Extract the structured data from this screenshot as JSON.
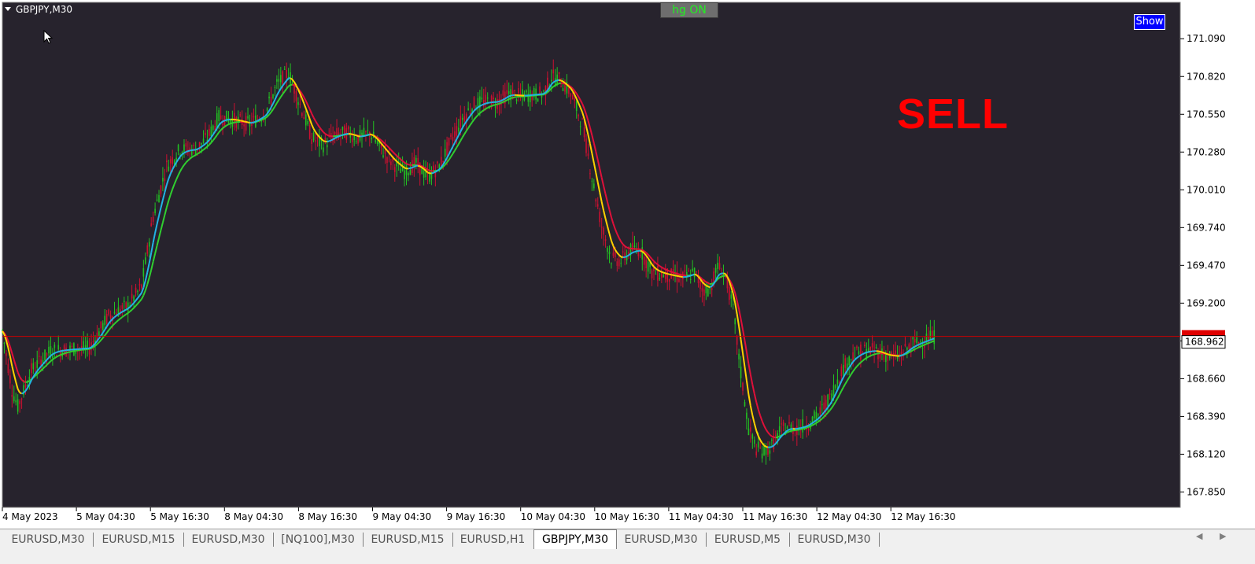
{
  "window": {
    "symbol_label": "GBPJPY,M30"
  },
  "toolbar": {
    "hg_label": "hg ON",
    "show_label": "Show"
  },
  "signal": {
    "text": "SELL",
    "color": "#ff0000"
  },
  "colors": {
    "background": "#27232d",
    "bull_candle": "#22c022",
    "bear_candle": "#cc1030",
    "fast_up": "#22b4e6",
    "fast_down": "#ffd200",
    "slow_up": "#30d030",
    "slow_down": "#e0103a",
    "price_line": "#cc0000",
    "axis_text": "#ffffff"
  },
  "chart_data": {
    "type": "line",
    "symbol": "GBPJPY",
    "timeframe": "M30",
    "ylim": [
      167.74,
      171.35
    ],
    "y_ticks": [
      "171.090",
      "170.820",
      "170.550",
      "170.280",
      "170.010",
      "169.740",
      "169.470",
      "169.200",
      "168.930",
      "168.660",
      "168.390",
      "168.120",
      "167.850"
    ],
    "x_ticks": [
      "4 May 2023",
      "5 May 04:30",
      "5 May 16:30",
      "8 May 04:30",
      "8 May 16:30",
      "9 May 04:30",
      "9 May 16:30",
      "10 May 04:30",
      "10 May 16:30",
      "11 May 04:30",
      "11 May 16:30",
      "12 May 04:30",
      "12 May 16:30"
    ],
    "current_price": 168.962,
    "current_price_label": "168.962",
    "grid": false,
    "price_path": [
      {
        "bar": 0,
        "price": 169.0
      },
      {
        "bar": 5,
        "price": 168.58
      },
      {
        "bar": 8,
        "price": 168.46
      },
      {
        "bar": 15,
        "price": 168.72
      },
      {
        "bar": 25,
        "price": 168.86
      },
      {
        "bar": 35,
        "price": 168.87
      },
      {
        "bar": 45,
        "price": 168.88
      },
      {
        "bar": 55,
        "price": 169.11
      },
      {
        "bar": 65,
        "price": 169.18
      },
      {
        "bar": 72,
        "price": 169.32
      },
      {
        "bar": 78,
        "price": 169.82
      },
      {
        "bar": 85,
        "price": 170.18
      },
      {
        "bar": 92,
        "price": 170.3
      },
      {
        "bar": 100,
        "price": 170.3
      },
      {
        "bar": 106,
        "price": 170.38
      },
      {
        "bar": 112,
        "price": 170.53
      },
      {
        "bar": 120,
        "price": 170.51
      },
      {
        "bar": 128,
        "price": 170.48
      },
      {
        "bar": 136,
        "price": 170.56
      },
      {
        "bar": 142,
        "price": 170.76
      },
      {
        "bar": 148,
        "price": 170.85
      },
      {
        "bar": 154,
        "price": 170.62
      },
      {
        "bar": 160,
        "price": 170.38
      },
      {
        "bar": 166,
        "price": 170.33
      },
      {
        "bar": 172,
        "price": 170.4
      },
      {
        "bar": 178,
        "price": 170.42
      },
      {
        "bar": 184,
        "price": 170.38
      },
      {
        "bar": 190,
        "price": 170.42
      },
      {
        "bar": 196,
        "price": 170.3
      },
      {
        "bar": 202,
        "price": 170.2
      },
      {
        "bar": 208,
        "price": 170.14
      },
      {
        "bar": 214,
        "price": 170.2
      },
      {
        "bar": 220,
        "price": 170.1
      },
      {
        "bar": 226,
        "price": 170.18
      },
      {
        "bar": 232,
        "price": 170.36
      },
      {
        "bar": 238,
        "price": 170.52
      },
      {
        "bar": 244,
        "price": 170.62
      },
      {
        "bar": 250,
        "price": 170.64
      },
      {
        "bar": 256,
        "price": 170.64
      },
      {
        "bar": 262,
        "price": 170.7
      },
      {
        "bar": 268,
        "price": 170.68
      },
      {
        "bar": 274,
        "price": 170.69
      },
      {
        "bar": 280,
        "price": 170.7
      },
      {
        "bar": 284,
        "price": 170.82
      },
      {
        "bar": 288,
        "price": 170.8
      },
      {
        "bar": 294,
        "price": 170.7
      },
      {
        "bar": 300,
        "price": 170.48
      },
      {
        "bar": 305,
        "price": 170.1
      },
      {
        "bar": 310,
        "price": 169.75
      },
      {
        "bar": 315,
        "price": 169.52
      },
      {
        "bar": 320,
        "price": 169.5
      },
      {
        "bar": 325,
        "price": 169.58
      },
      {
        "bar": 330,
        "price": 169.58
      },
      {
        "bar": 336,
        "price": 169.42
      },
      {
        "bar": 344,
        "price": 169.4
      },
      {
        "bar": 352,
        "price": 169.38
      },
      {
        "bar": 358,
        "price": 169.42
      },
      {
        "bar": 362,
        "price": 169.3
      },
      {
        "bar": 366,
        "price": 169.3
      },
      {
        "bar": 370,
        "price": 169.46
      },
      {
        "bar": 374,
        "price": 169.4
      },
      {
        "bar": 378,
        "price": 169.15
      },
      {
        "bar": 382,
        "price": 168.7
      },
      {
        "bar": 386,
        "price": 168.3
      },
      {
        "bar": 390,
        "price": 168.16
      },
      {
        "bar": 394,
        "price": 168.14
      },
      {
        "bar": 398,
        "price": 168.18
      },
      {
        "bar": 402,
        "price": 168.28
      },
      {
        "bar": 406,
        "price": 168.32
      },
      {
        "bar": 410,
        "price": 168.3
      },
      {
        "bar": 416,
        "price": 168.33
      },
      {
        "bar": 422,
        "price": 168.4
      },
      {
        "bar": 428,
        "price": 168.52
      },
      {
        "bar": 434,
        "price": 168.72
      },
      {
        "bar": 440,
        "price": 168.83
      },
      {
        "bar": 446,
        "price": 168.86
      },
      {
        "bar": 452,
        "price": 168.86
      },
      {
        "bar": 458,
        "price": 168.82
      },
      {
        "bar": 464,
        "price": 168.82
      },
      {
        "bar": 470,
        "price": 168.9
      },
      {
        "bar": 476,
        "price": 168.93
      },
      {
        "bar": 482,
        "price": 168.96
      }
    ]
  },
  "tabs": [
    {
      "label": "EURUSD,M30",
      "active": false
    },
    {
      "label": "EURUSD,M15",
      "active": false
    },
    {
      "label": "EURUSD,M30",
      "active": false
    },
    {
      "label": "[NQ100],M30",
      "active": false
    },
    {
      "label": "EURUSD,M15",
      "active": false
    },
    {
      "label": "EURUSD,H1",
      "active": false
    },
    {
      "label": "GBPJPY,M30",
      "active": true
    },
    {
      "label": "EURUSD,M30",
      "active": false
    },
    {
      "label": "EURUSD,M5",
      "active": false
    },
    {
      "label": "EURUSD,M30",
      "active": false
    }
  ],
  "tab_nav": {
    "prev": "◀",
    "next": "▶"
  }
}
